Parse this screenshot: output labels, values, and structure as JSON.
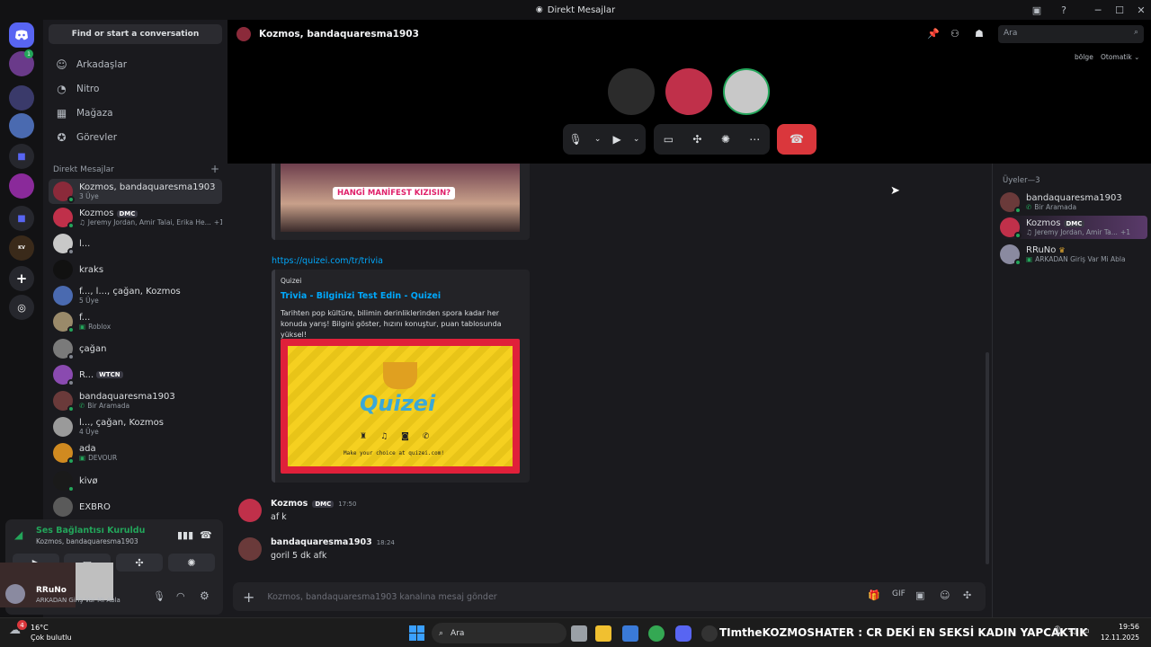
{
  "window": {
    "title": "Direkt Mesajlar"
  },
  "dm_sidebar": {
    "search_placeholder": "Find or start a conversation",
    "nav": [
      {
        "label": "Arkadaşlar",
        "icon": "friends-icon"
      },
      {
        "label": "Nitro",
        "icon": "nitro-icon"
      },
      {
        "label": "Mağaza",
        "icon": "shop-icon"
      },
      {
        "label": "Görevler",
        "icon": "quests-icon"
      }
    ],
    "section_title": "Direkt Mesajlar",
    "dms": [
      {
        "name": "Kozmos, bandaquaresma1903",
        "sub": "3 Üye",
        "color": "#8b2a3a"
      },
      {
        "name": "Kozmos",
        "badge": "DMC",
        "sub": "Jeremy Jordan, Amir Talai, Erika He...",
        "sub_extra": "+1",
        "color": "#c0304a"
      },
      {
        "name": "l...",
        "sub": "",
        "color": "#c8c8c8"
      },
      {
        "name": "kraks",
        "sub": "",
        "color": "#111111"
      },
      {
        "name": "f..., l..., çağan, Kozmos",
        "sub": "5 Üye",
        "color": "#4a6ab0"
      },
      {
        "name": "f...",
        "sub": "Roblox",
        "color": "#9a8a6a"
      },
      {
        "name": "çağan",
        "sub": "",
        "color": "#7a7a7a"
      },
      {
        "name": "R...",
        "badge": "WTCN",
        "sub": "",
        "color": "#8a4ab0"
      },
      {
        "name": "bandaquaresma1903",
        "sub": "Bir Aramada",
        "color": "#6a3a3a"
      },
      {
        "name": "l..., çağan, Kozmos",
        "sub": "4 Üye",
        "color": "#9a9a9a"
      },
      {
        "name": "ada",
        "sub": "DEVOUR",
        "color": "#d08a20"
      },
      {
        "name": "kivø",
        "sub": "",
        "color": "#1a1a1a"
      },
      {
        "name": "EXBRO",
        "sub": "",
        "color": "#5a5a5a"
      }
    ],
    "voice": {
      "status": "Ses Bağlantısı Kuruldu",
      "channel": "Kozmos, bandaquaresma1903"
    },
    "user": {
      "name": "RRuNo",
      "status": "ARKADAN Giriş Var Mi Abla"
    }
  },
  "header": {
    "title": "Kozmos, bandaquaresma1903",
    "search_placeholder": "Ara",
    "region_label": "bölge",
    "region_value": "Otomatik"
  },
  "chat": {
    "embed1_image_text": "HANGİ MANİFEST KIZISIN?",
    "link": "https://quizei.com/tr/trivia",
    "embed2": {
      "provider": "Quizei",
      "title": "Trivia - Bilginizi Test Edin - Quizei",
      "description": "Tarihten pop kültüre, bilimin derinliklerinden spora kadar her konuda yarış! Bilgini göster, hızını konuştur, puan tablosunda yüksel!",
      "image_logo": "Quizei",
      "image_caption": "Make your choice at quizei.com!"
    },
    "messages": [
      {
        "author": "Kozmos",
        "badge": "DMC",
        "time": "17:50",
        "text": "af k"
      },
      {
        "author": "bandaquaresma1903",
        "time": "18:24",
        "text": "goril 5 dk afk"
      }
    ],
    "composer_placeholder": "Kozmos, bandaquaresma1903 kanalına mesaj gönder"
  },
  "members": {
    "title": "Üyeler—3",
    "list": [
      {
        "name": "bandaquaresma1903",
        "sub": "Bir Aramada"
      },
      {
        "name": "Kozmos",
        "badge": "DMC",
        "sub": "Jeremy Jordan, Amir Ta...",
        "sub_extra": "+1"
      },
      {
        "name": "RRuNo",
        "sub": "ARKADAN Giriş Var Mi Abla"
      }
    ]
  },
  "taskbar": {
    "weather_temp": "16°C",
    "weather_text": "Çok bulutlu",
    "search_label": "Ara",
    "ticker": "TImtheKOZMOSHATER : CR DEKİ EN SEKSİ KADIN YAPCAKTIK",
    "time": "19:56",
    "date": "12.11.2025",
    "notification_count": "4"
  },
  "colors": {
    "accent": "#5865f2",
    "online": "#23a55a",
    "hangup": "#da373c",
    "link": "#00a8fc"
  }
}
